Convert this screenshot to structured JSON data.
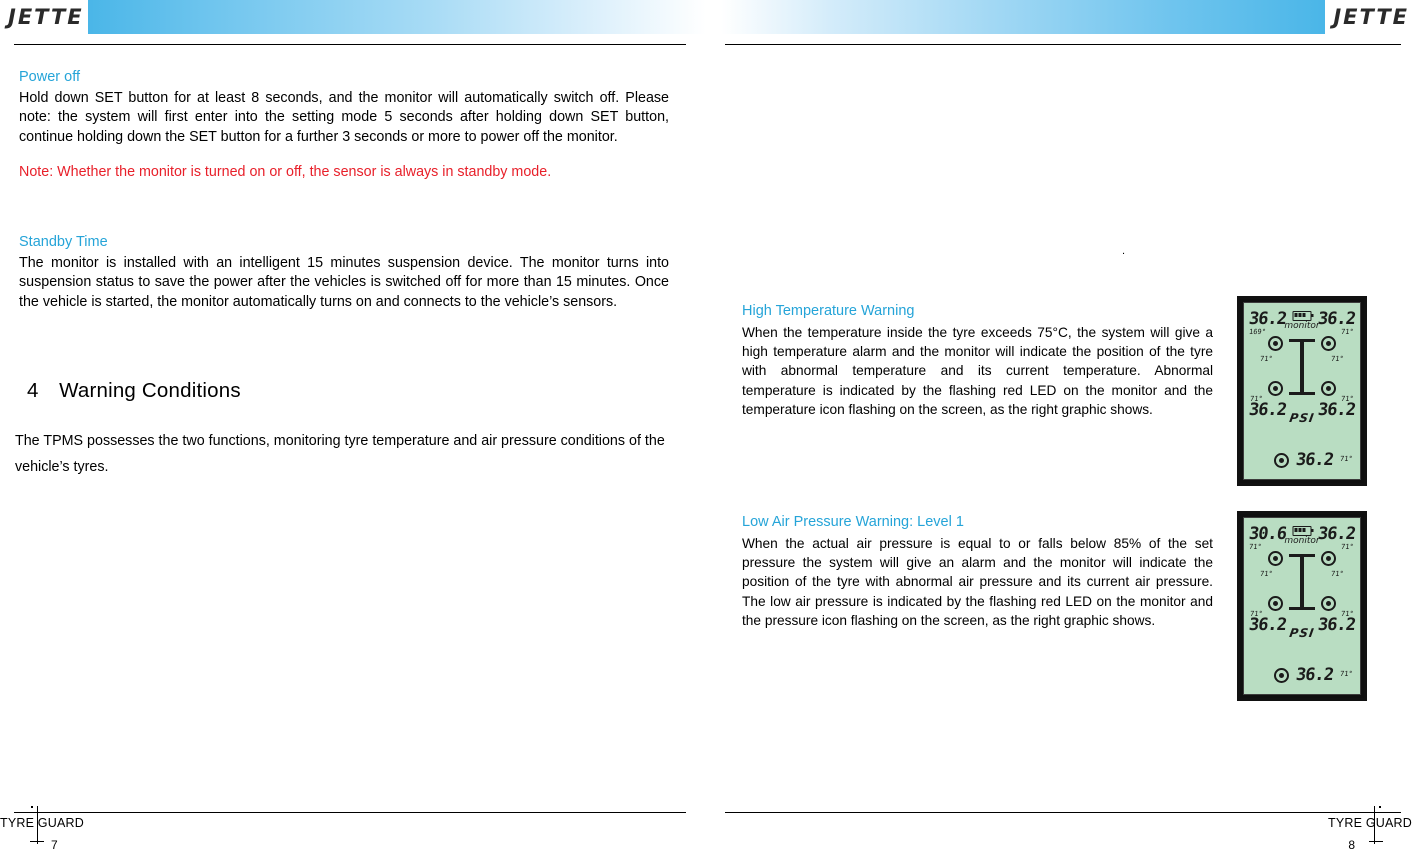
{
  "brand": "JETTE",
  "footer": {
    "label": "TYRE GUARD",
    "page_left": "7",
    "page_right": "8"
  },
  "left_page": {
    "power_off": {
      "heading": "Power off",
      "body": "Hold down SET button for at least 8 seconds, and the monitor will automatically switch off. Please note: the system will first enter into the setting mode 5 seconds after holding down SET button, continue holding down the SET button for a further 3 seconds or more to power off the monitor.",
      "note": "Note: Whether the monitor is turned on or off, the sensor is always in standby mode."
    },
    "standby_time": {
      "heading": "Standby Time",
      "body": "The monitor is installed with an intelligent 15 minutes suspension device. The monitor turns into suspension status to save the power after the vehicles is switched off for more than 15 minutes. Once the vehicle is started, the monitor automatically turns on and connects to the vehicle’s sensors."
    },
    "section": {
      "number": "4",
      "title": "Warning Conditions",
      "body": "The TPMS possesses the two functions, monitoring tyre temperature and air pressure conditions of the vehicle’s tyres."
    }
  },
  "right_page": {
    "stray_dot": ".",
    "high_temp": {
      "heading": "High Temperature Warning",
      "body": "When the temperature inside the tyre exceeds 75°C, the system will give a high temperature alarm and the monitor will indicate the position of the tyre with abnormal temperature and its current temperature. Abnormal temperature is indicated by the flashing red LED on the monitor and the temperature icon flashing on the screen, as the right graphic shows."
    },
    "low_pressure": {
      "heading": "Low Air Pressure Warning: Level 1",
      "body": "When the actual air pressure is equal to or falls below 85% of the set pressure the system will give an alarm and the monitor will indicate the position of the tyre with abnormal air pressure and its current air pressure. The low air pressure is indicated by the flashing red LED on the monitor and the pressure icon flashing on the screen, as the right graphic shows."
    },
    "lcd_temp": {
      "monitor_label": "monitor",
      "front_left_value": "36.2",
      "front_left_temp": "169°",
      "front_right_value": "36.2",
      "front_right_temp": "71°",
      "rear_left_value": "36.2",
      "rear_left_temp": "71°",
      "rear_right_value": "36.2",
      "rear_right_temp": "71°",
      "mid_left_temp": "71°",
      "mid_right_temp": "71°",
      "unit": "PSI",
      "spare_value": "36.2",
      "spare_temp": "71°"
    },
    "lcd_pressure": {
      "monitor_label": "monitor",
      "front_left_value": "30.6",
      "front_left_temp": "71°",
      "front_right_value": "36.2",
      "front_right_temp": "71°",
      "rear_left_value": "36.2",
      "rear_left_temp": "71°",
      "rear_right_value": "36.2",
      "rear_right_temp": "71°",
      "mid_left_temp": "71°",
      "mid_right_temp": "71°",
      "unit": "PSI",
      "spare_value": "36.2",
      "spare_temp": "71°"
    }
  }
}
